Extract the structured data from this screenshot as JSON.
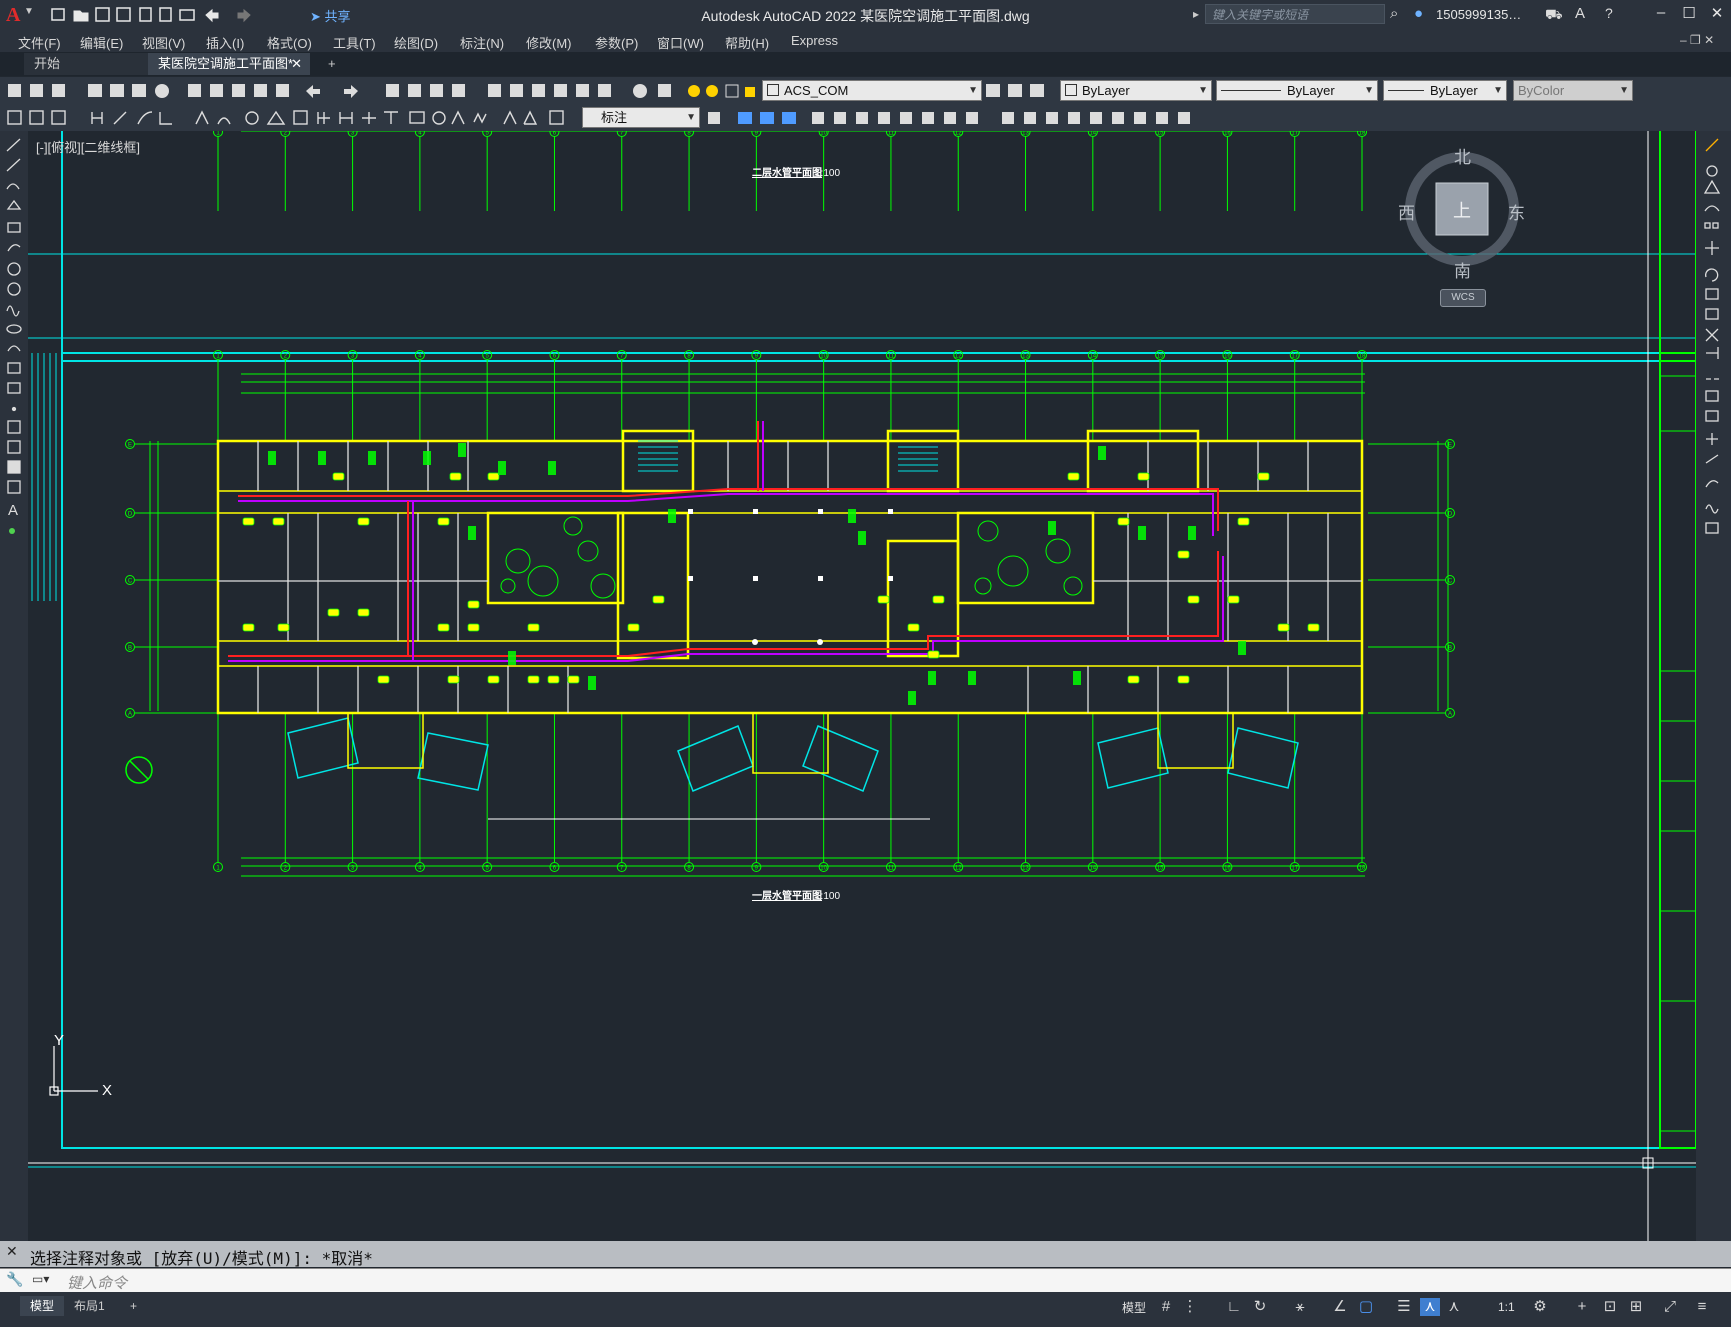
{
  "app": {
    "title": "Autodesk AutoCAD 2022    某医院空调施工平面图.dwg",
    "logo": "A",
    "share_label": "共享",
    "search_placeholder": "键入关键字或短语",
    "user": "1505999135…"
  },
  "menu": [
    "文件(F)",
    "编辑(E)",
    "视图(V)",
    "插入(I)",
    "格式(O)",
    "工具(T)",
    "绘图(D)",
    "标注(N)",
    "修改(M)",
    "参数(P)",
    "窗口(W)",
    "帮助(H)",
    "Express"
  ],
  "tabs": {
    "start": "开始",
    "active": "某医院空调施工平面图*",
    "close": "✕",
    "add": "+"
  },
  "toolbar": {
    "layer": "ACS_COM",
    "color": "ByLayer",
    "linetype": "ByLayer",
    "lineweight": "ByLayer",
    "plotstyle": "ByColor",
    "dimstyle": "标注"
  },
  "viewport": {
    "label": "[-][俯视][二维线框]"
  },
  "viewcube": {
    "north": "北",
    "south": "南",
    "east": "东",
    "west": "西",
    "top": "上",
    "wcs": "WCS"
  },
  "drawing": {
    "title_upper": "二层水管平面图",
    "title_lower": "一层水管平面图",
    "scale": "1:100",
    "axis_numbers": [
      "1",
      "2",
      "3",
      "4",
      "5",
      "6",
      "7",
      "8",
      "9",
      "10",
      "11",
      "12",
      "13",
      "14",
      "15",
      "16",
      "17",
      "18"
    ],
    "axis_letters": [
      "E",
      "D",
      "C",
      "B",
      "A"
    ]
  },
  "ucs": {
    "x": "X",
    "y": "Y"
  },
  "command": {
    "history": "选择注释对象或 [放弃(U)/模式(M)]: *取消*",
    "placeholder": "键入命令"
  },
  "status": {
    "model_tab": "模型",
    "layout_tab": "布局1",
    "add": "+",
    "model_button": "模型",
    "scale": "1:1"
  },
  "colors": {
    "canvas": "#212830",
    "frame": "#00e5e5",
    "wall": "#ffff00",
    "grid": "#00ff00",
    "pipe_red": "#ff2020",
    "pipe_magenta": "#c000ff"
  }
}
